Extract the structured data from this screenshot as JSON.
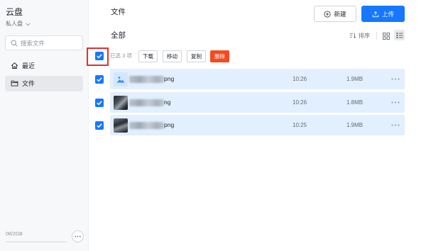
{
  "sidebar": {
    "title": "云盘",
    "drive_name": "私人盘",
    "search": {
      "placeholder": "搜索文件"
    },
    "nav": [
      {
        "label": "最近",
        "icon": "home-icon"
      },
      {
        "label": "文件",
        "icon": "folder-icon",
        "selected": true
      }
    ],
    "storage": {
      "text": "08/2GB",
      "used_fraction": 0
    }
  },
  "header": {
    "title": "文件",
    "new_label": "新建",
    "new_icon": "plus-circle-icon",
    "upload_label": "上传",
    "upload_icon": "upload-icon"
  },
  "list_header": {
    "heading": "全部",
    "sort_label": "排序",
    "active_view_icon": "list-icon"
  },
  "selection": {
    "all_checked": true,
    "count_text": "已选 3 项",
    "actions": {
      "download": "下载",
      "move": "移动",
      "copy": "复制",
      "delete": "删除"
    }
  },
  "files": [
    {
      "name_suffix": "png",
      "time": "10:26",
      "size": "1.9MB",
      "checked": true,
      "thumbnail_icon": "image-icon"
    },
    {
      "name_suffix": "ng",
      "time": "10:26",
      "size": "1.8MB",
      "checked": true
    },
    {
      "name_suffix": "png",
      "time": "10:25",
      "size": "1.9MB",
      "checked": true
    }
  ],
  "colors": {
    "primary": "#1677ff",
    "danger": "#f54a1f",
    "selected_row": "#e1effe",
    "highlight": "#e4312b"
  }
}
